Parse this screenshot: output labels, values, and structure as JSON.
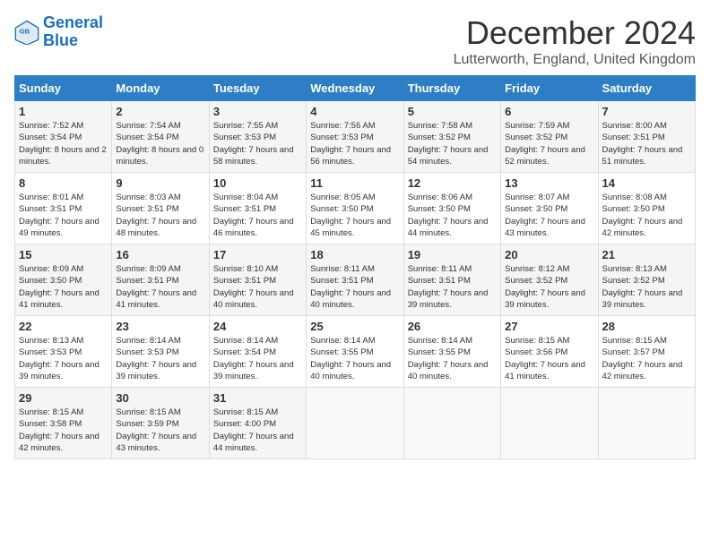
{
  "logo": {
    "line1": "General",
    "line2": "Blue"
  },
  "title": "December 2024",
  "subtitle": "Lutterworth, England, United Kingdom",
  "headers": [
    "Sunday",
    "Monday",
    "Tuesday",
    "Wednesday",
    "Thursday",
    "Friday",
    "Saturday"
  ],
  "weeks": [
    [
      {
        "day": "1",
        "sunrise": "7:52 AM",
        "sunset": "3:54 PM",
        "daylight": "8 hours and 2 minutes."
      },
      {
        "day": "2",
        "sunrise": "7:54 AM",
        "sunset": "3:54 PM",
        "daylight": "8 hours and 0 minutes."
      },
      {
        "day": "3",
        "sunrise": "7:55 AM",
        "sunset": "3:53 PM",
        "daylight": "7 hours and 58 minutes."
      },
      {
        "day": "4",
        "sunrise": "7:56 AM",
        "sunset": "3:53 PM",
        "daylight": "7 hours and 56 minutes."
      },
      {
        "day": "5",
        "sunrise": "7:58 AM",
        "sunset": "3:52 PM",
        "daylight": "7 hours and 54 minutes."
      },
      {
        "day": "6",
        "sunrise": "7:59 AM",
        "sunset": "3:52 PM",
        "daylight": "7 hours and 52 minutes."
      },
      {
        "day": "7",
        "sunrise": "8:00 AM",
        "sunset": "3:51 PM",
        "daylight": "7 hours and 51 minutes."
      }
    ],
    [
      {
        "day": "8",
        "sunrise": "8:01 AM",
        "sunset": "3:51 PM",
        "daylight": "7 hours and 49 minutes."
      },
      {
        "day": "9",
        "sunrise": "8:03 AM",
        "sunset": "3:51 PM",
        "daylight": "7 hours and 48 minutes."
      },
      {
        "day": "10",
        "sunrise": "8:04 AM",
        "sunset": "3:51 PM",
        "daylight": "7 hours and 46 minutes."
      },
      {
        "day": "11",
        "sunrise": "8:05 AM",
        "sunset": "3:50 PM",
        "daylight": "7 hours and 45 minutes."
      },
      {
        "day": "12",
        "sunrise": "8:06 AM",
        "sunset": "3:50 PM",
        "daylight": "7 hours and 44 minutes."
      },
      {
        "day": "13",
        "sunrise": "8:07 AM",
        "sunset": "3:50 PM",
        "daylight": "7 hours and 43 minutes."
      },
      {
        "day": "14",
        "sunrise": "8:08 AM",
        "sunset": "3:50 PM",
        "daylight": "7 hours and 42 minutes."
      }
    ],
    [
      {
        "day": "15",
        "sunrise": "8:09 AM",
        "sunset": "3:50 PM",
        "daylight": "7 hours and 41 minutes."
      },
      {
        "day": "16",
        "sunrise": "8:09 AM",
        "sunset": "3:51 PM",
        "daylight": "7 hours and 41 minutes."
      },
      {
        "day": "17",
        "sunrise": "8:10 AM",
        "sunset": "3:51 PM",
        "daylight": "7 hours and 40 minutes."
      },
      {
        "day": "18",
        "sunrise": "8:11 AM",
        "sunset": "3:51 PM",
        "daylight": "7 hours and 40 minutes."
      },
      {
        "day": "19",
        "sunrise": "8:11 AM",
        "sunset": "3:51 PM",
        "daylight": "7 hours and 39 minutes."
      },
      {
        "day": "20",
        "sunrise": "8:12 AM",
        "sunset": "3:52 PM",
        "daylight": "7 hours and 39 minutes."
      },
      {
        "day": "21",
        "sunrise": "8:13 AM",
        "sunset": "3:52 PM",
        "daylight": "7 hours and 39 minutes."
      }
    ],
    [
      {
        "day": "22",
        "sunrise": "8:13 AM",
        "sunset": "3:53 PM",
        "daylight": "7 hours and 39 minutes."
      },
      {
        "day": "23",
        "sunrise": "8:14 AM",
        "sunset": "3:53 PM",
        "daylight": "7 hours and 39 minutes."
      },
      {
        "day": "24",
        "sunrise": "8:14 AM",
        "sunset": "3:54 PM",
        "daylight": "7 hours and 39 minutes."
      },
      {
        "day": "25",
        "sunrise": "8:14 AM",
        "sunset": "3:55 PM",
        "daylight": "7 hours and 40 minutes."
      },
      {
        "day": "26",
        "sunrise": "8:14 AM",
        "sunset": "3:55 PM",
        "daylight": "7 hours and 40 minutes."
      },
      {
        "day": "27",
        "sunrise": "8:15 AM",
        "sunset": "3:56 PM",
        "daylight": "7 hours and 41 minutes."
      },
      {
        "day": "28",
        "sunrise": "8:15 AM",
        "sunset": "3:57 PM",
        "daylight": "7 hours and 42 minutes."
      }
    ],
    [
      {
        "day": "29",
        "sunrise": "8:15 AM",
        "sunset": "3:58 PM",
        "daylight": "7 hours and 42 minutes."
      },
      {
        "day": "30",
        "sunrise": "8:15 AM",
        "sunset": "3:59 PM",
        "daylight": "7 hours and 43 minutes."
      },
      {
        "day": "31",
        "sunrise": "8:15 AM",
        "sunset": "4:00 PM",
        "daylight": "7 hours and 44 minutes."
      },
      null,
      null,
      null,
      null
    ]
  ]
}
